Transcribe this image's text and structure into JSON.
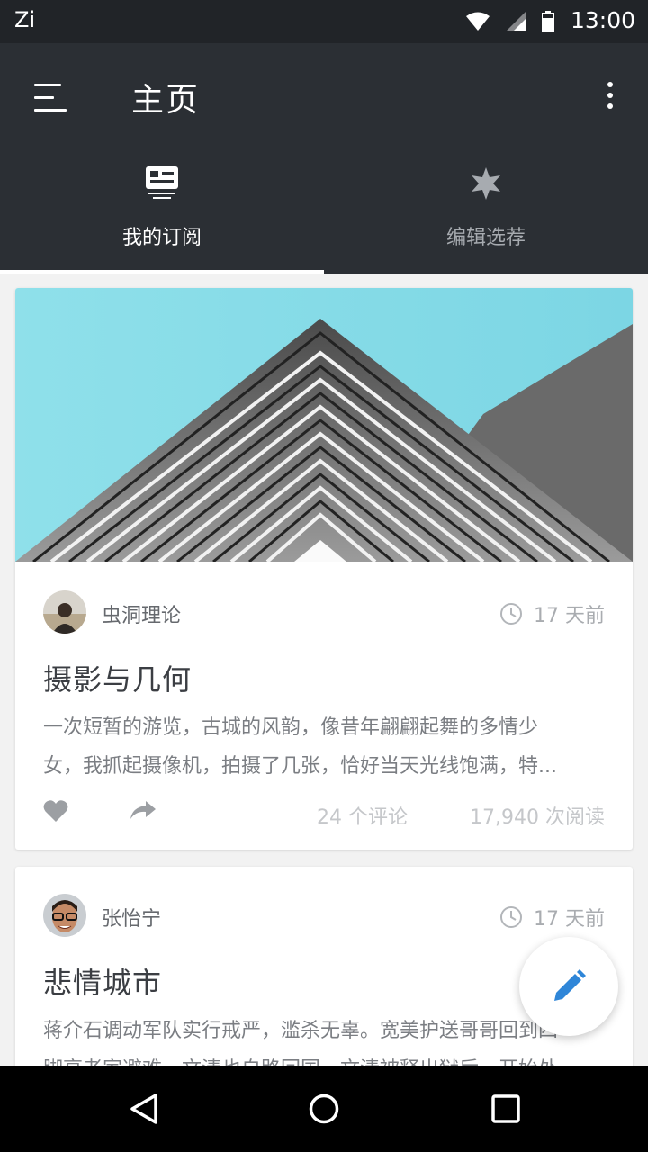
{
  "status_bar": {
    "app_label": "Zi",
    "time": "13:00"
  },
  "app_bar": {
    "title": "主页"
  },
  "tabs": [
    {
      "label": "我的订阅",
      "icon": "subscription-card-icon",
      "selected": true
    },
    {
      "label": "编辑选荐",
      "icon": "star-icon",
      "selected": false
    }
  ],
  "feed": [
    {
      "author": "虫洞理论",
      "time": "17 天前",
      "title": "摄影与几何",
      "excerpt_line1": "一次短暂的游览，古城的风韵，像昔年翩翩起舞的多情少",
      "excerpt_line2": "女，我抓起摄像机，拍摄了几张，恰好当天光线饱满，特...",
      "comments": "24 个评论",
      "reads": "17,940 次阅读"
    },
    {
      "author": "张怡宁",
      "time": "17 天前",
      "title": "悲情城市",
      "excerpt_line1": "蒋介石调动军队实行戒严，滥杀无辜。宽美护送哥哥回到四",
      "excerpt_line2": "脚亮老家避难，文清也自路回国，文清被释出狱后，开始处"
    }
  ],
  "colors": {
    "app_bar": "#2b2f34",
    "status_bar": "#212428",
    "accent": "#2f86d8",
    "sky": "#8fe0ea"
  }
}
